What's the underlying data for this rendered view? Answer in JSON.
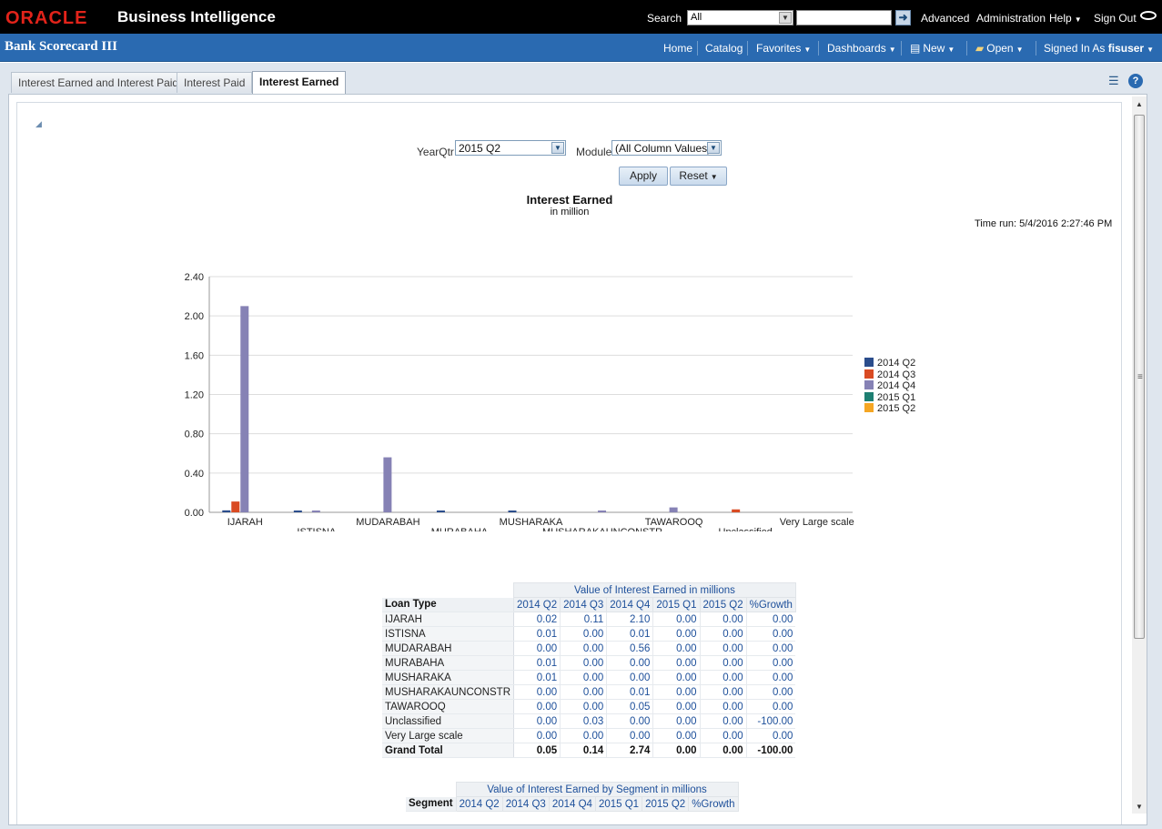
{
  "topbar": {
    "logo": "ORACLE",
    "product": "Business Intelligence",
    "search_label": "Search",
    "search_scope": "All",
    "search_value": "",
    "links": {
      "advanced": "Advanced",
      "administration": "Administration",
      "help": "Help",
      "sign_out": "Sign Out"
    }
  },
  "header": {
    "title": "Bank Scorecard III",
    "nav": {
      "home": "Home",
      "catalog": "Catalog",
      "favorites": "Favorites",
      "dashboards": "Dashboards",
      "new": "New",
      "open": "Open",
      "signed_in_as": "Signed In As",
      "user": "fisuser"
    }
  },
  "tabs": [
    {
      "label": "Interest Earned and Interest Paid",
      "active": false
    },
    {
      "label": "Interest Paid",
      "active": false
    },
    {
      "label": "Interest Earned",
      "active": true
    }
  ],
  "prompts": {
    "yearqtr_label": "YearQtr",
    "yearqtr_value": "2015 Q2",
    "module_label": "Module",
    "module_value": "(All Column Values)",
    "apply": "Apply",
    "reset": "Reset"
  },
  "report": {
    "title": "Interest Earned",
    "subtitle": "in million",
    "time_run": "Time run: 5/4/2016 2:27:46 PM"
  },
  "chart_data": {
    "type": "bar",
    "title": "Interest Earned",
    "subtitle": "in million",
    "categories": [
      "IJARAH",
      "ISTISNA",
      "MUDARABAH",
      "MURABAHA",
      "MUSHARAKA",
      "MUSHARAKAUNCONSTR",
      "TAWAROOQ",
      "Unclassified",
      "Very Large scale"
    ],
    "series": [
      {
        "name": "2014 Q2",
        "color": "#2b4d8c",
        "values": [
          0.02,
          0.01,
          0.0,
          0.01,
          0.01,
          0.0,
          0.0,
          0.0,
          0.0
        ]
      },
      {
        "name": "2014 Q3",
        "color": "#d94b23",
        "values": [
          0.11,
          0.0,
          0.0,
          0.0,
          0.0,
          0.0,
          0.0,
          0.03,
          0.0
        ]
      },
      {
        "name": "2014 Q4",
        "color": "#8682b5",
        "values": [
          2.1,
          0.01,
          0.56,
          0.0,
          0.0,
          0.01,
          0.05,
          0.0,
          0.0
        ]
      },
      {
        "name": "2015 Q1",
        "color": "#1e7f72",
        "values": [
          0.0,
          0.0,
          0.0,
          0.0,
          0.0,
          0.0,
          0.0,
          0.0,
          0.0
        ]
      },
      {
        "name": "2015 Q2",
        "color": "#f5a623",
        "values": [
          0.0,
          0.0,
          0.0,
          0.0,
          0.0,
          0.0,
          0.0,
          0.0,
          0.0
        ]
      }
    ],
    "yticks": [
      "0.00",
      "0.40",
      "0.80",
      "1.20",
      "1.60",
      "2.00",
      "2.40"
    ],
    "ylim": [
      0,
      2.4
    ],
    "grid": true,
    "legend": "right"
  },
  "table1": {
    "title": "Value of Interest Earned in millions",
    "row_header": "Loan Type",
    "columns": [
      "2014 Q2",
      "2014 Q3",
      "2014 Q4",
      "2015 Q1",
      "2015 Q2",
      "%Growth"
    ],
    "rows": [
      {
        "label": "IJARAH",
        "values": [
          "0.02",
          "0.11",
          "2.10",
          "0.00",
          "0.00",
          "0.00"
        ]
      },
      {
        "label": "ISTISNA",
        "values": [
          "0.01",
          "0.00",
          "0.01",
          "0.00",
          "0.00",
          "0.00"
        ]
      },
      {
        "label": "MUDARABAH",
        "values": [
          "0.00",
          "0.00",
          "0.56",
          "0.00",
          "0.00",
          "0.00"
        ]
      },
      {
        "label": "MURABAHA",
        "values": [
          "0.01",
          "0.00",
          "0.00",
          "0.00",
          "0.00",
          "0.00"
        ]
      },
      {
        "label": "MUSHARAKA",
        "values": [
          "0.01",
          "0.00",
          "0.00",
          "0.00",
          "0.00",
          "0.00"
        ]
      },
      {
        "label": "MUSHARAKAUNCONSTR",
        "values": [
          "0.00",
          "0.00",
          "0.01",
          "0.00",
          "0.00",
          "0.00"
        ]
      },
      {
        "label": "TAWAROOQ",
        "values": [
          "0.00",
          "0.00",
          "0.05",
          "0.00",
          "0.00",
          "0.00"
        ]
      },
      {
        "label": "Unclassified",
        "values": [
          "0.00",
          "0.03",
          "0.00",
          "0.00",
          "0.00",
          "-100.00"
        ]
      },
      {
        "label": "Very Large scale",
        "values": [
          "0.00",
          "0.00",
          "0.00",
          "0.00",
          "0.00",
          "0.00"
        ]
      }
    ],
    "total": {
      "label": "Grand Total",
      "values": [
        "0.05",
        "0.14",
        "2.74",
        "0.00",
        "0.00",
        "-100.00"
      ]
    }
  },
  "table2": {
    "title": "Value of Interest Earned by Segment in millions",
    "row_header": "Segment",
    "columns": [
      "2014 Q2",
      "2014 Q3",
      "2014 Q4",
      "2015 Q1",
      "2015 Q2",
      "%Growth"
    ]
  }
}
